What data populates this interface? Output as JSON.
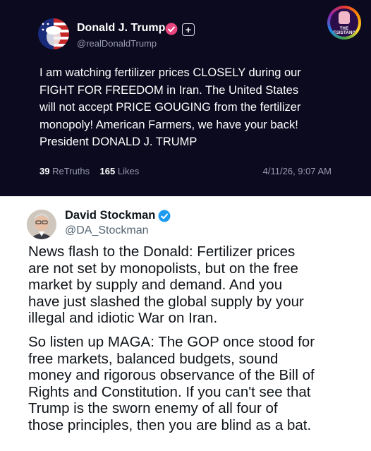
{
  "truth_post": {
    "display_name": "Donald J. Trump",
    "handle": "@realDonaldTrump",
    "follow_symbol": "+",
    "body_lines": [
      "I am watching fertilizer prices CLOSELY during our",
      "FIGHT FOR FREEDOM in Iran. The United States",
      "will not accept PRICE GOUGING from the fertilizer",
      "monopoly! American Farmers, we have your back!",
      "President DONALD J. TRUMP"
    ],
    "retruths_count": "39",
    "retruths_label": "ReTruths",
    "likes_count": "165",
    "likes_label": "Likes",
    "timestamp": "4/11/26, 9:07 AM",
    "verified_color": "#e8457e"
  },
  "resistance_badge": {
    "line1": "THE",
    "line2": "RESISTANCE"
  },
  "reply_post": {
    "display_name": "David Stockman",
    "handle": "@DA_Stockman",
    "verified_color": "#1d9bf0",
    "paragraph1_lines": [
      "News flash to the Donald: Fertilizer prices",
      "are not set by monopolists, but on the free",
      "market by supply and demand. And you",
      "have just slashed the global supply by your",
      "illegal and idiotic War on Iran."
    ],
    "paragraph2_lines": [
      "So listen up MAGA: The GOP once stood for",
      "free markets, balanced budgets, sound",
      "money and rigorous observance of the Bill of",
      "Rights and Constitution. If you can't see that",
      "Trump is the sworn enemy of all four of",
      "those principles, then you are blind as a bat."
    ]
  }
}
